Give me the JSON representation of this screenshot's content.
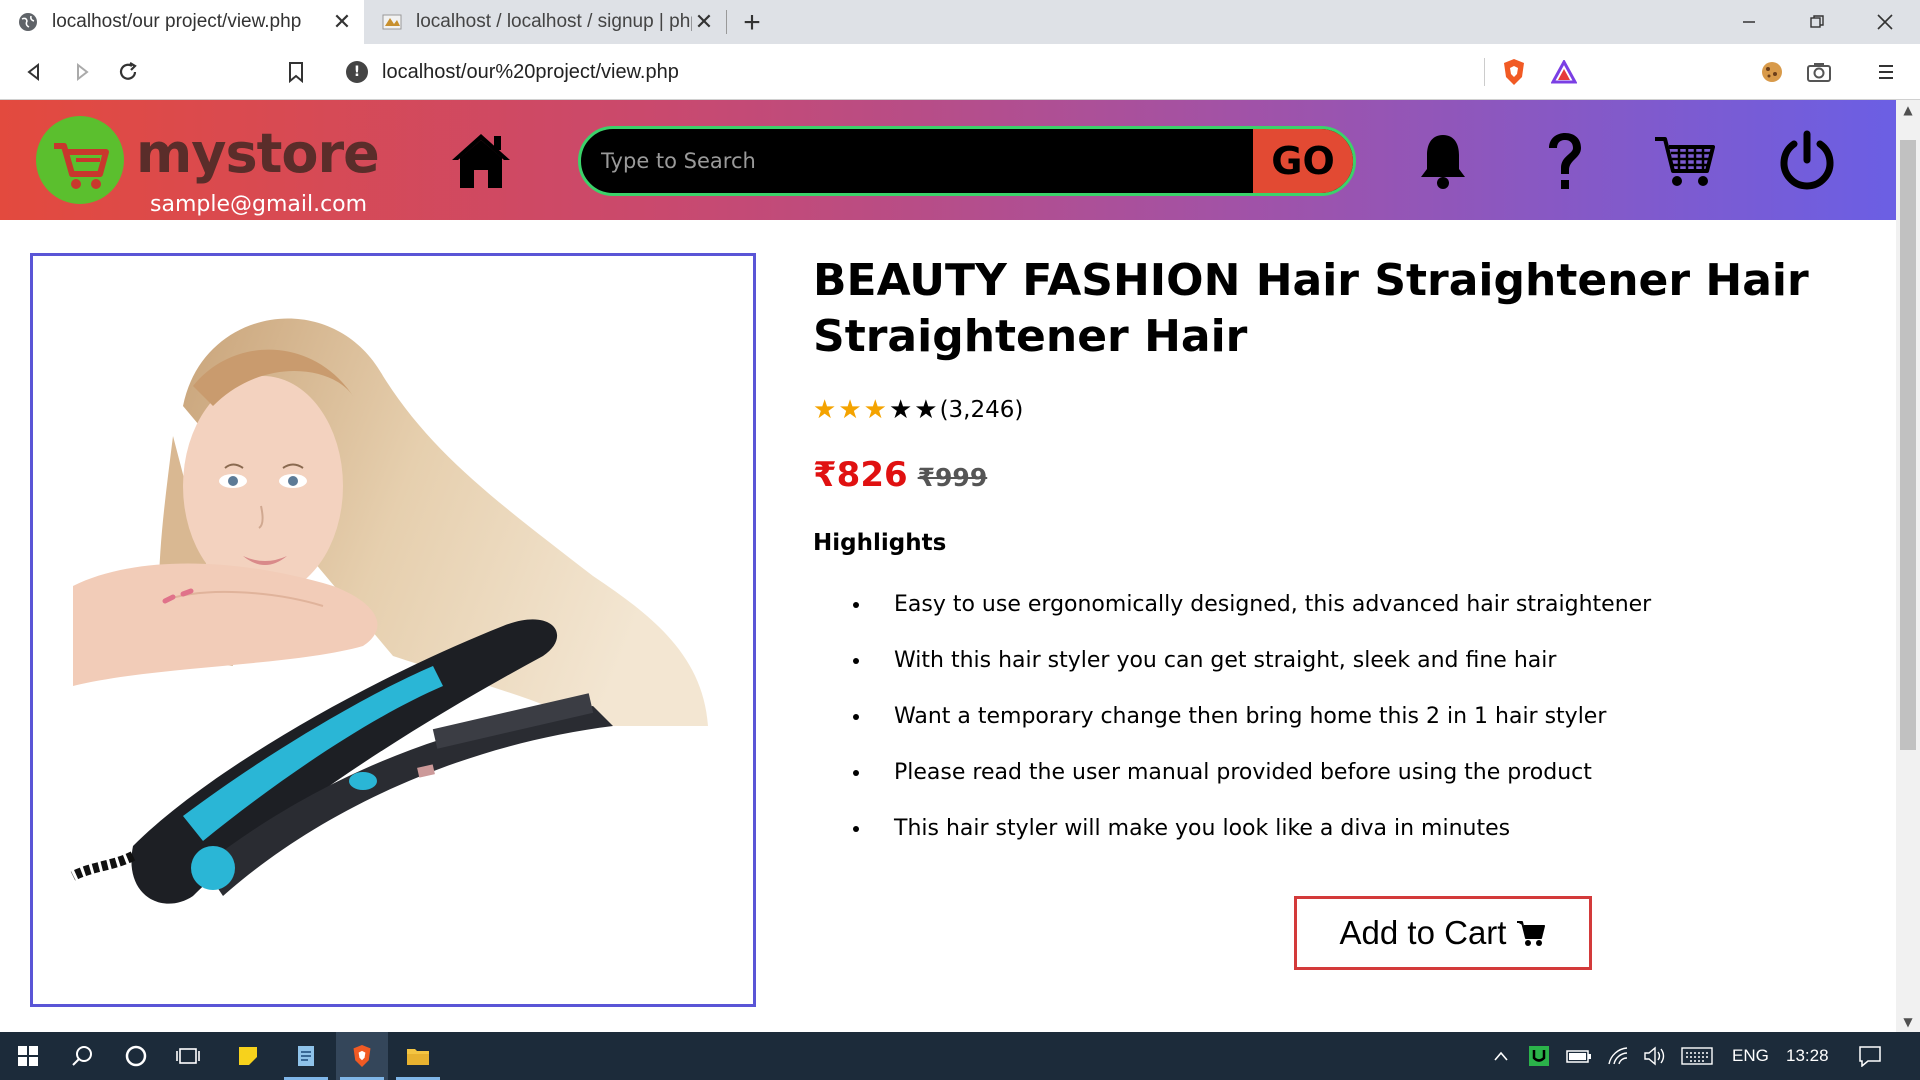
{
  "browser": {
    "tabs": [
      {
        "title": "localhost/our project/view.php",
        "active": true
      },
      {
        "title": "localhost / localhost / signup | php",
        "active": false
      }
    ],
    "url": "localhost/our%20project/view.php"
  },
  "header": {
    "logo_text": "mystore",
    "email": "sample@gmail.com",
    "search_placeholder": "Type to Search",
    "search_button": "GO"
  },
  "product": {
    "title": "BEAUTY FASHION Hair Straightener Hair Straightener Hair",
    "rating_stars": 3,
    "rating_max": 5,
    "rating_count": "(3,246)",
    "price": "₹826",
    "original_price": "₹999",
    "highlights_heading": "Highlights",
    "highlights": [
      "Easy to use ergonomically designed, this advanced hair straightener",
      "With this hair styler you can get straight, sleek and fine hair",
      "Want a temporary change then bring home this 2 in 1 hair styler",
      "Please read the user manual provided before using the product",
      "This hair styler will make you look like a diva in minutes"
    ],
    "add_to_cart": "Add to Cart"
  },
  "taskbar": {
    "language": "ENG",
    "time": "13:28"
  },
  "colors": {
    "header_start": "#e34a3e",
    "header_end": "#6b5fe4",
    "search_border": "#3bd26a",
    "go_button": "#e24a33",
    "price": "#e01111",
    "star": "#f4a300",
    "cart_border": "#d33a3a",
    "image_border": "#5a55d6"
  }
}
